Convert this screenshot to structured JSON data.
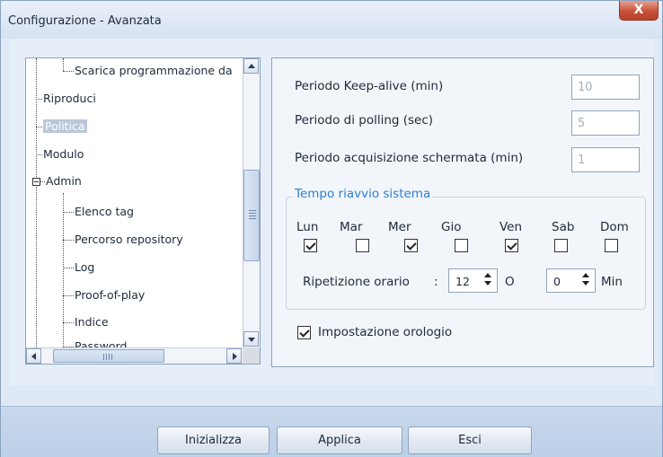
{
  "window": {
    "title": "Configurazione - Avanzata",
    "close_label": "X"
  },
  "tree": {
    "items": [
      {
        "label": "Scarica programmazione da",
        "level": 2,
        "selected": false
      },
      {
        "label": "Riproduci",
        "level": 1,
        "selected": false
      },
      {
        "label": "Politica",
        "level": 1,
        "selected": true
      },
      {
        "label": "Modulo",
        "level": 1,
        "selected": false
      },
      {
        "label": "Admin",
        "level": 1,
        "selected": false,
        "expanded": true
      },
      {
        "label": "Elenco tag",
        "level": 2,
        "selected": false
      },
      {
        "label": "Percorso repository",
        "level": 2,
        "selected": false
      },
      {
        "label": "Log",
        "level": 2,
        "selected": false
      },
      {
        "label": "Proof-of-play",
        "level": 2,
        "selected": false
      },
      {
        "label": "Indice",
        "level": 2,
        "selected": false
      },
      {
        "label": "Password",
        "level": 2,
        "selected": false
      }
    ]
  },
  "settings": {
    "keepalive_label": "Periodo Keep-alive (min)",
    "keepalive_value": "10",
    "polling_label": "Periodo di polling (sec)",
    "polling_value": "5",
    "screenshot_label": "Periodo acquisizione schermata (min)",
    "screenshot_value": "1"
  },
  "restart": {
    "group_title": "Tempo riavvio sistema",
    "days": [
      {
        "label": "Lun",
        "checked": true
      },
      {
        "label": "Mar",
        "checked": false
      },
      {
        "label": "Mer",
        "checked": true
      },
      {
        "label": "Gio",
        "checked": false
      },
      {
        "label": "Ven",
        "checked": true
      },
      {
        "label": "Sab",
        "checked": false
      },
      {
        "label": "Dom",
        "checked": false
      }
    ],
    "repeat_label": "Ripetizione orario",
    "colon": ":",
    "hour_value": "12",
    "hour_unit": "O",
    "minute_value": "0",
    "minute_unit": "Min"
  },
  "clock": {
    "label": "Impostazione orologio",
    "checked": true
  },
  "buttons": {
    "initialize": "Inizializza",
    "apply": "Applica",
    "exit": "Esci"
  }
}
